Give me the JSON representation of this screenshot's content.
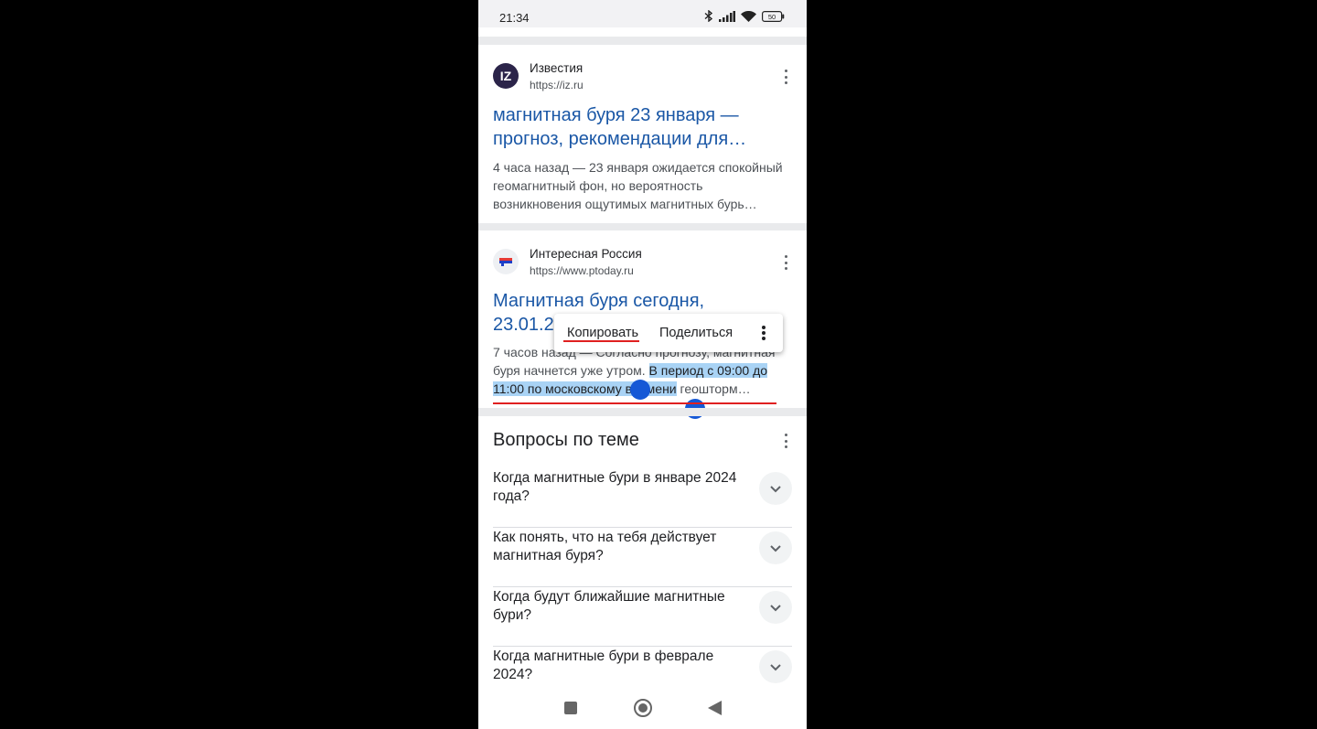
{
  "status_bar": {
    "time": "21:34",
    "battery": "50"
  },
  "results": [
    {
      "site_name": "Известия",
      "url": "https://iz.ru",
      "favicon_text": "IZ",
      "title_lines": [
        "магнитная буря 23 января —",
        "прогноз, рекомендации для…"
      ],
      "snippet_lines": [
        "4 часа назад — 23 января ожидается спокойный",
        "геомагнитный фон, но вероятность",
        "возникновения ощутимых магнитных бурь…"
      ]
    },
    {
      "site_name": "Интересная Россия",
      "url": "https://www.ptoday.ru",
      "title_lines": [
        "Магнитная буря сегодня,",
        "23.01.20"
      ],
      "snippet_line1": "7 часов назад — Согласно прогнозу, магнитная",
      "snippet_line2_plain": "буря начнется уже утром. ",
      "snippet_line2_selected": "В период с 09:00 до",
      "snippet_line3_selected": "11:00 по московскому времени",
      "snippet_line3_plain": " геошторм…"
    }
  ],
  "context_menu": {
    "copy_label": "Копировать",
    "share_label": "Поделиться"
  },
  "related_questions": {
    "title": "Вопросы по теме",
    "items": [
      {
        "question": "Когда магнитные бури в январе 2024 года?"
      },
      {
        "question": "Как понять, что на тебя действует магнитная буря?"
      },
      {
        "question": "Когда будут ближайшие магнитные бури?"
      },
      {
        "question": "Когда магнитные бури в феврале 2024?"
      }
    ]
  },
  "colors": {
    "link": "#1a57a6",
    "selection": "#a9d3f5",
    "handle": "#1558d6",
    "annotation_underline": "#e02020"
  },
  "icons": [
    "bluetooth-icon",
    "signal-icon",
    "wifi-icon",
    "battery-icon",
    "more-vert-icon",
    "chevron-down-icon",
    "recent-apps-icon",
    "home-icon",
    "back-icon"
  ]
}
